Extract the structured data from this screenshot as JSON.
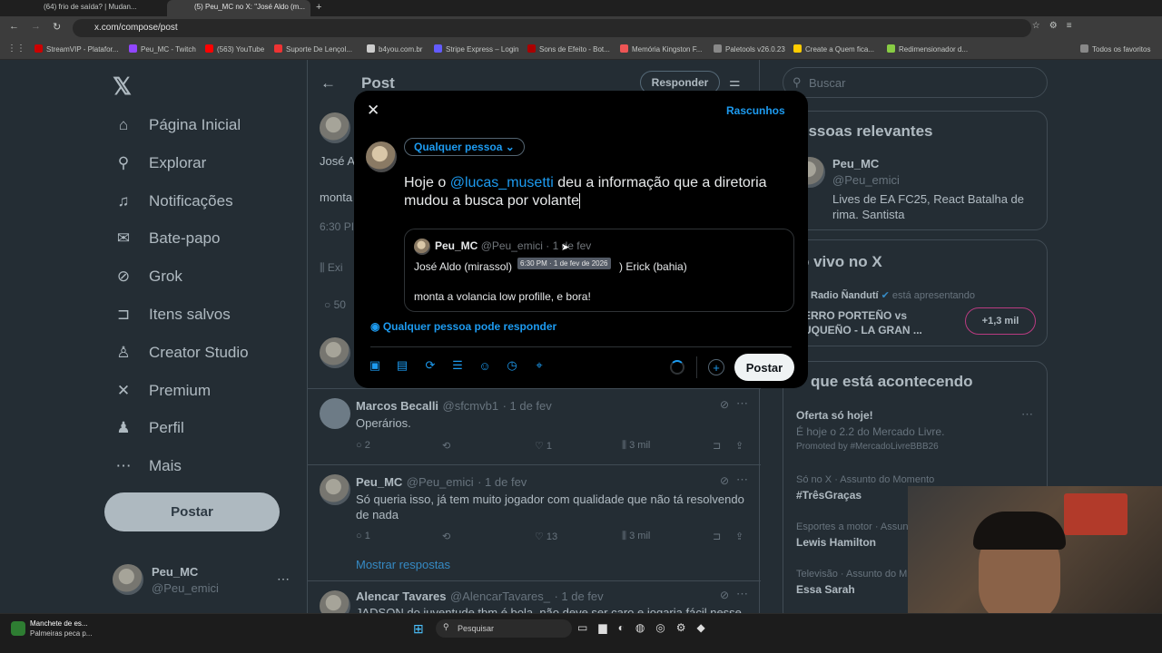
{
  "browser": {
    "tabs": [
      {
        "label": "(64) frio de saída? | Mudan..."
      },
      {
        "label": "(5) Peu_MC no X: \"José Aldo (m..."
      }
    ],
    "url": "x.com/compose/post",
    "bookmarks": [
      "StreamVIP - Platafor...",
      "Peu_MC - Twitch",
      "(563) YouTube",
      "Suporte De Lençol...",
      "b4you.com.br",
      "Stripe Express – Login",
      "Sons de Efeito - Bot...",
      "Memória Kingston F...",
      "Paletools v26.0.23",
      "Create a Quem fica...",
      "Redimensionador d..."
    ],
    "all_bookmarks": "Todos os favoritos",
    "bookmark_colors": [
      "#c00",
      "#9146ff",
      "#f00",
      "#e33",
      "#ccc",
      "#635bff",
      "#a00",
      "#e55",
      "#888",
      "#fc0",
      "#8c4"
    ]
  },
  "sidebar": {
    "items": [
      {
        "label": "Página Inicial",
        "icon": "home-icon"
      },
      {
        "label": "Explorar",
        "icon": "search-icon"
      },
      {
        "label": "Notificações",
        "icon": "bell-icon"
      },
      {
        "label": "Bate-papo",
        "icon": "mail-icon"
      },
      {
        "label": "Grok",
        "icon": "grok-icon"
      },
      {
        "label": "Itens salvos",
        "icon": "bookmark-icon"
      },
      {
        "label": "Creator Studio",
        "icon": "creator-icon"
      },
      {
        "label": "Premium",
        "icon": "x-logo-icon"
      },
      {
        "label": "Perfil",
        "icon": "person-icon"
      },
      {
        "label": "Mais",
        "icon": "more-icon"
      }
    ],
    "post_button": "Postar",
    "account": {
      "name": "Peu_MC",
      "handle": "@Peu_emici"
    }
  },
  "center": {
    "header_title": "Post",
    "reply_button": "Responder",
    "fragments": {
      "name_start": "José A",
      "text_start": "monta",
      "time_start": "6:30 PI",
      "views_start": "Exi",
      "replies_start": "50"
    },
    "tweets": [
      {
        "name": "Marcos Becalli",
        "handle": "@sfcmvb1",
        "date": "· 1 de fev",
        "text": "Operários.",
        "replies": "2",
        "likes": "1",
        "views": "3 mil"
      },
      {
        "name": "Peu_MC",
        "handle": "@Peu_emici",
        "date": "· 1 de fev",
        "text": "Só queria isso, já tem muito jogador com qualidade que não tá resolvendo de nada",
        "replies": "1",
        "likes": "13",
        "views": "3 mil",
        "show_replies": "Mostrar respostas"
      },
      {
        "name": "Alencar Tavares",
        "handle": "@AlencarTavares_",
        "date": "· 1 de fev",
        "text": "JADSON do juventude tbm é bola, não deve ser caro e jogaria fácil nesse"
      }
    ]
  },
  "right": {
    "search_placeholder": "Buscar",
    "relevant": {
      "title": "essoas relevantes",
      "name": "Peu_MC",
      "handle": "@Peu_emici",
      "bio": "Lives de EA FC25, React Batalha de rima. Santista"
    },
    "live": {
      "title": "o vivo no X",
      "host": "Radio Ñandutí",
      "status": "está apresentando",
      "line1": "ERRO PORTEÑO vs",
      "line2": "UQUEÑO - LA GRAN ...",
      "count": "+1,3 mil"
    },
    "trends": {
      "title": "que está acontecendo",
      "items": [
        {
          "name": "Oferta só hoje!",
          "desc": "É hoje o 2.2 do Mercado Livre.",
          "meta": "Promoted by #MercadoLivreBBB26"
        },
        {
          "meta": "Só no X · Assunto do Momento",
          "name": "#TrêsGraças"
        },
        {
          "meta": "Esportes a motor · Assun",
          "name": "Lewis Hamilton"
        },
        {
          "meta": "Televisão · Assunto do M",
          "name": "Essa Sarah"
        }
      ]
    }
  },
  "modal": {
    "drafts": "Rascunhos",
    "audience": "Qualquer pessoa",
    "text_before": "Hoje o ",
    "mention": "@lucas_musetti",
    "text_after": " deu a informação que a diretoria mudou a busca por volante",
    "quote": {
      "name": "Peu_MC",
      "handle": "@Peu_emici",
      "date": "· 1 de fev",
      "line1_a": "José Aldo (mirassol)",
      "line1_b": ") Erick (bahia)",
      "line2": "monta a volancia low profille, e bora!",
      "tooltip": "6:30 PM · 1 de fev de 2026"
    },
    "reply_setting": "Qualquer pessoa pode responder",
    "post_button": "Postar"
  },
  "taskbar": {
    "notif_title": "Manchete de es...",
    "notif_sub": "Palmeiras peca p...",
    "search": "Pesquisar"
  }
}
